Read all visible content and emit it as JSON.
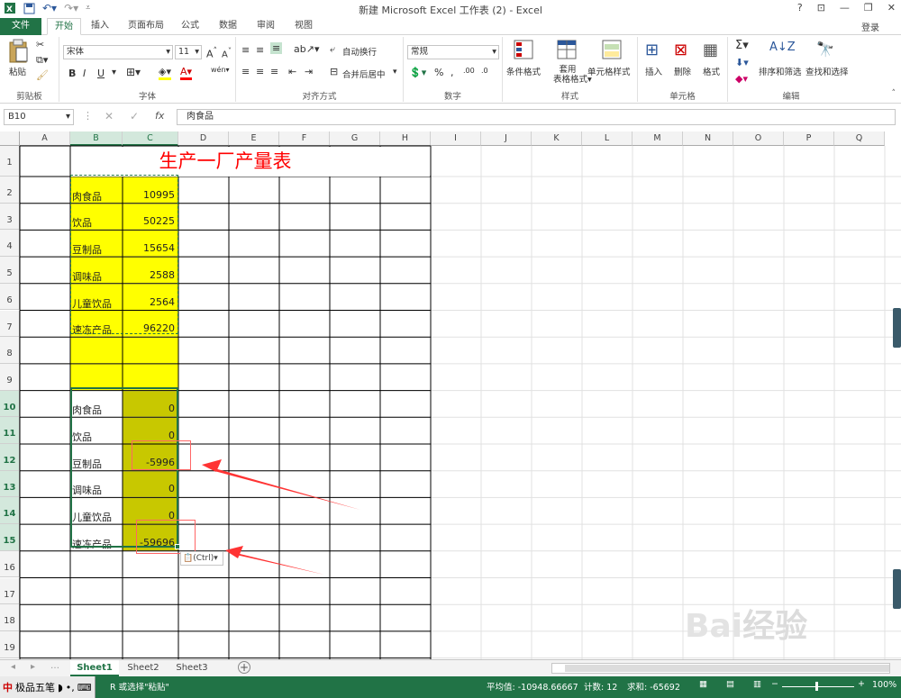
{
  "window": {
    "title": "新建 Microsoft Excel 工作表 (2) - Excel",
    "login": "登录",
    "help": "?"
  },
  "tabs": [
    "文件",
    "开始",
    "插入",
    "页面布局",
    "公式",
    "数据",
    "审阅",
    "视图"
  ],
  "ribbon": {
    "clipboard": {
      "paste": "粘贴",
      "label": "剪贴板"
    },
    "font": {
      "name": "宋体",
      "size": "11",
      "label": "字体",
      "bold": "B",
      "italic": "I",
      "underline": "U"
    },
    "alignment": {
      "wrap": "自动换行",
      "merge": "合并后居中",
      "label": "对齐方式"
    },
    "number": {
      "format": "常规",
      "label": "数字"
    },
    "styles": {
      "conditional": "条件格式",
      "table": "套用\n表格格式",
      "cell": "单元格样式",
      "label": "样式"
    },
    "cells": {
      "insert": "插入",
      "delete": "删除",
      "format": "格式",
      "label": "单元格"
    },
    "editing": {
      "sort": "排序和筛选",
      "find": "查找和选择",
      "label": "编辑"
    }
  },
  "formula_bar": {
    "name_box": "B10",
    "fx": "fx",
    "content": "肉食品"
  },
  "columns": [
    "A",
    "B",
    "C",
    "D",
    "E",
    "F",
    "G",
    "H",
    "I",
    "J",
    "K",
    "L",
    "M",
    "N",
    "O",
    "P",
    "Q"
  ],
  "rows": [
    "1",
    "2",
    "3",
    "4",
    "5",
    "6",
    "7",
    "8",
    "9",
    "10",
    "11",
    "12",
    "13",
    "14",
    "15",
    "16",
    "17",
    "18",
    "19"
  ],
  "sheet_title": "生产一厂产量表",
  "table_top": [
    {
      "name": "肉食品",
      "value": "10995"
    },
    {
      "name": "饮品",
      "value": "50225"
    },
    {
      "name": "豆制品",
      "value": "15654"
    },
    {
      "name": "调味品",
      "value": "2588"
    },
    {
      "name": "儿童饮品",
      "value": "2564"
    },
    {
      "name": "速冻产品",
      "value": "96220"
    }
  ],
  "table_bottom": [
    {
      "name": "肉食品",
      "value": "0"
    },
    {
      "name": "饮品",
      "value": "0"
    },
    {
      "name": "豆制品",
      "value": "-5996"
    },
    {
      "name": "调味品",
      "value": "0"
    },
    {
      "name": "儿童饮品",
      "value": "0"
    },
    {
      "name": "速冻产品",
      "value": "-59696"
    }
  ],
  "paste_options": "(Ctrl)",
  "sheets": [
    "Sheet1",
    "Sheet2",
    "Sheet3"
  ],
  "status": {
    "ime": "极品五笔",
    "message": "R 或选择\"粘贴\"",
    "average": "平均值: -10948.66667",
    "count": "计数: 12",
    "sum": "求和: -65692",
    "zoom": "100%"
  },
  "colors": {
    "excel_green": "#217346",
    "yellow_fill": "#ffff00",
    "olive_fill": "#c8c800",
    "title_red": "#ff0000",
    "annotation_red": "#ff3333"
  }
}
